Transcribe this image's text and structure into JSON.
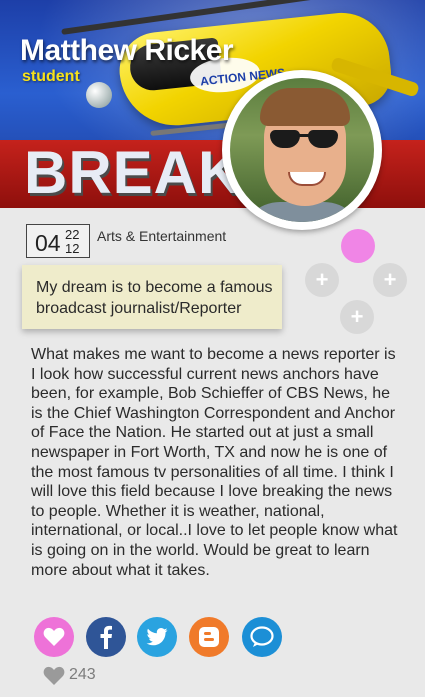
{
  "profile": {
    "name": "Matthew Ricker",
    "role": "student"
  },
  "banner": {
    "headline": "BREAKIN",
    "station_logo": "ACTION NEWS"
  },
  "post": {
    "date": {
      "day": "04",
      "month": "22",
      "year": "12"
    },
    "category": "Arts & Entertainment",
    "dream": "My dream is to become a famous broadcast journalist/Reporter",
    "story": "What makes me want to become a news reporter is I look how successful current news anchors have been, for example, Bob Schieffer of CBS News, he is the Chief Washington Correspondent and Anchor of Face the Nation.  He started out at just a small newspaper in Fort Worth, TX and now he is one of the most famous tv personalities of all time. I think I will love this field because I love breaking the news to people.  Whether it is weather, national, international, or local..I love to let people know what is going on in the world. Would be great to learn more about what it takes."
  },
  "actions": {
    "plus_label": "+"
  },
  "social": {
    "items": [
      "heart",
      "facebook",
      "twitter",
      "blogger",
      "chat"
    ],
    "likes": "243"
  },
  "colors": {
    "accent_pink": "#ee72d8",
    "facebook": "#2f5597",
    "twitter": "#2aa3e0",
    "blogger": "#f07a2a",
    "chat": "#1c8fd6",
    "role_yellow": "#f6e21a"
  }
}
